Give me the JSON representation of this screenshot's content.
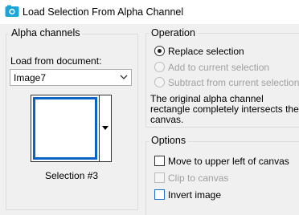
{
  "window": {
    "title": "Load Selection From Alpha Channel",
    "icon": "paintshop-app-icon"
  },
  "alpha_group": {
    "legend": "Alpha channels",
    "load_from_label": "Load from document:",
    "document_select": {
      "selected": "Image7"
    },
    "selection_name": "Selection #3"
  },
  "operation_group": {
    "legend": "Operation",
    "options": [
      {
        "label": "Replace selection",
        "selected": true,
        "enabled": true
      },
      {
        "label": "Add to current selection",
        "selected": false,
        "enabled": false
      },
      {
        "label": "Subtract from current selection",
        "selected": false,
        "enabled": false
      }
    ],
    "message_lines": [
      "The original alpha channel",
      "rectangle completely intersects the",
      "canvas."
    ]
  },
  "options_group": {
    "legend": "Options",
    "checkboxes": [
      {
        "label": "Move to upper left of canvas",
        "checked": false,
        "enabled": true
      },
      {
        "label": "Clip to canvas",
        "checked": false,
        "enabled": false
      },
      {
        "label": "Invert image",
        "checked": false,
        "enabled": true
      }
    ]
  },
  "colors": {
    "accent": "#0a64c8",
    "background": "#f0f0f0",
    "disabled_text": "#a0a0a0"
  }
}
